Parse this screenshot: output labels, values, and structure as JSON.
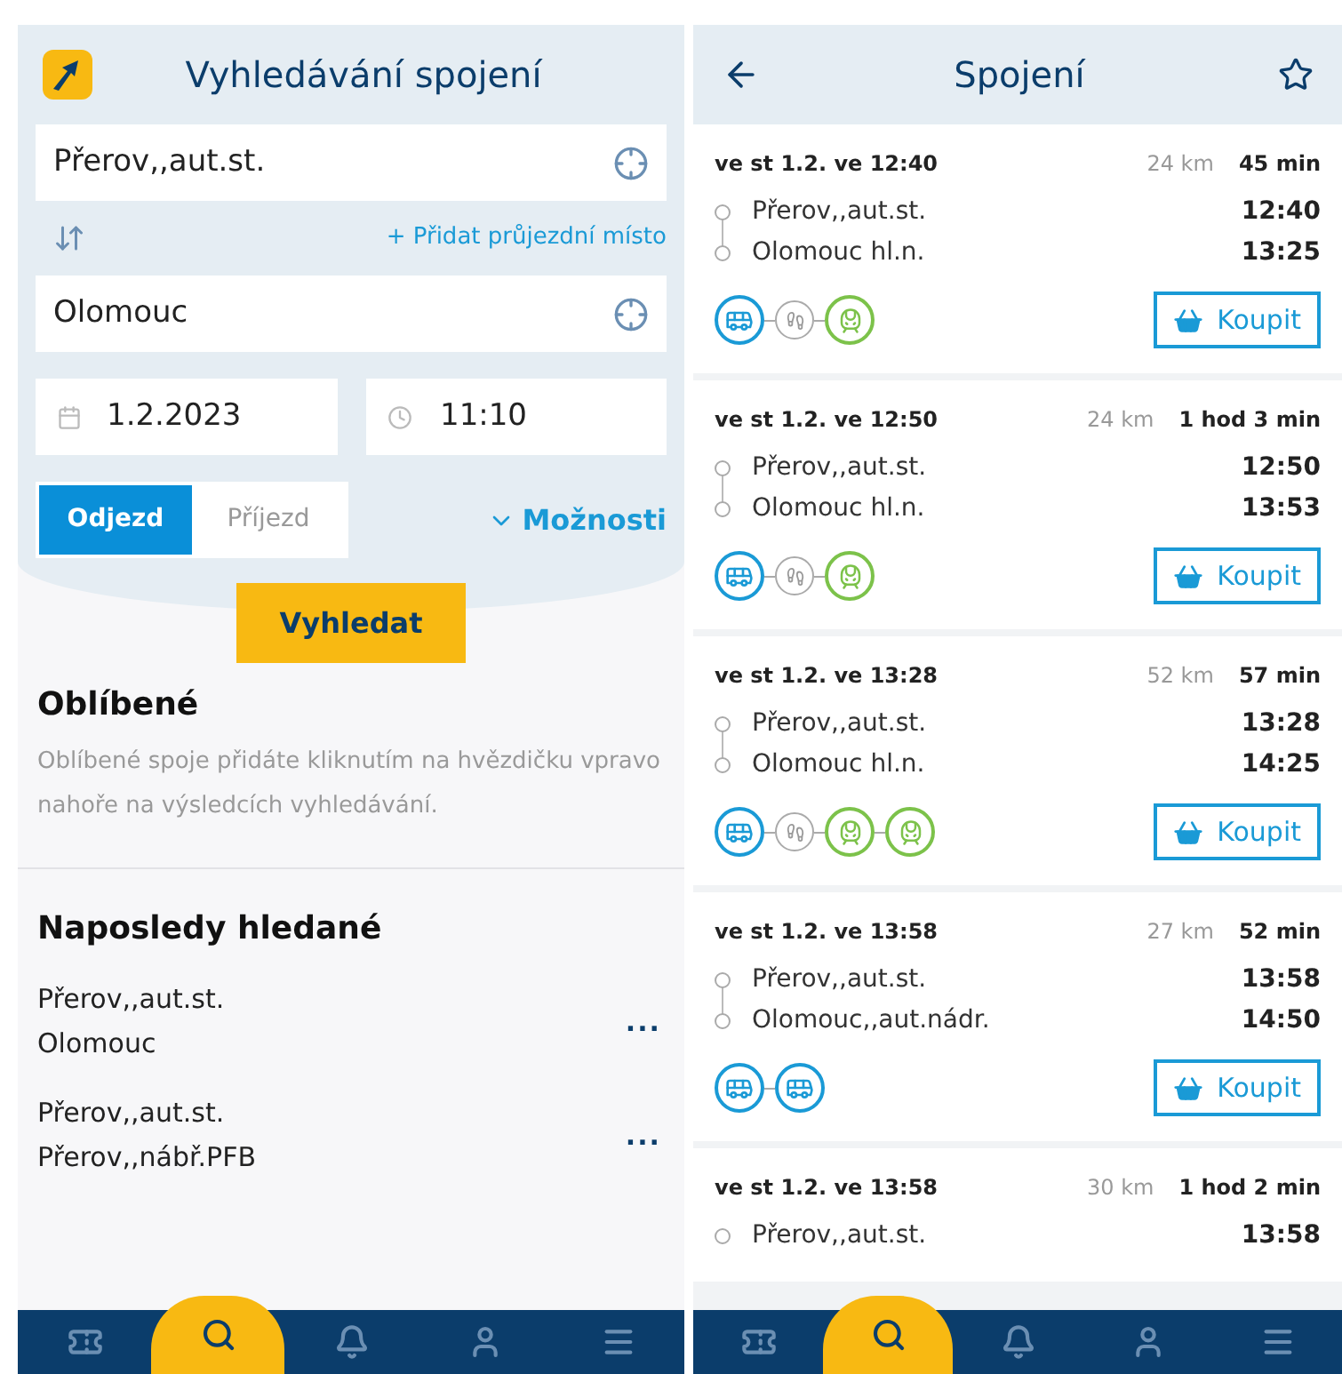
{
  "search_screen": {
    "title": "Vyhledávání spojení",
    "from": {
      "value": "Přerov,,aut.st."
    },
    "add_via": "+ Přidat průjezdní místo",
    "to": {
      "value": "Olomouc"
    },
    "date": {
      "value": "1.2.2023"
    },
    "time": {
      "value": "11:10"
    },
    "mode_tabs": [
      {
        "label": "Odjezd",
        "selected": true
      },
      {
        "label": "Příjezd",
        "selected": false
      }
    ],
    "options": "Možnosti",
    "search_button": "Vyhledat",
    "favorites": {
      "title": "Oblíbené",
      "text": "Oblíbené spoje přidáte kliknutím na hvězdičku vpravo nahoře na výsledcích vyhledávání."
    },
    "recent": {
      "title": "Naposledy hledané",
      "items": [
        {
          "from": "Přerov,,aut.st.",
          "to": "Olomouc",
          "menu": "..."
        },
        {
          "from": "Přerov,,aut.st.",
          "to": "Přerov,,nábř.PFB",
          "menu": "..."
        }
      ]
    },
    "nav": [
      {
        "kind": "ticket",
        "selected": false
      },
      {
        "kind": "search",
        "selected": true
      },
      {
        "kind": "bell",
        "selected": false
      },
      {
        "kind": "user",
        "selected": false
      },
      {
        "kind": "menu",
        "selected": false
      }
    ]
  },
  "results_screen": {
    "title": "Spojení",
    "connections": [
      {
        "date_label": "ve st 1.2. ve 12:40",
        "distance": "24 km",
        "duration": "45 min",
        "stops": [
          {
            "name": "Přerov,,aut.st.",
            "time": "12:40"
          },
          {
            "name": "Olomouc hl.n.",
            "time": "13:25"
          }
        ],
        "legs": [
          {
            "kind": "bus"
          },
          {
            "kind": "walk"
          },
          {
            "kind": "train"
          }
        ],
        "buy": "Koupit"
      },
      {
        "date_label": "ve st 1.2. ve 12:50",
        "distance": "24 km",
        "duration": "1 hod 3 min",
        "stops": [
          {
            "name": "Přerov,,aut.st.",
            "time": "12:50"
          },
          {
            "name": "Olomouc hl.n.",
            "time": "13:53"
          }
        ],
        "legs": [
          {
            "kind": "bus"
          },
          {
            "kind": "walk"
          },
          {
            "kind": "train"
          }
        ],
        "buy": "Koupit"
      },
      {
        "date_label": "ve st 1.2. ve 13:28",
        "distance": "52 km",
        "duration": "57 min",
        "stops": [
          {
            "name": "Přerov,,aut.st.",
            "time": "13:28"
          },
          {
            "name": "Olomouc hl.n.",
            "time": "14:25"
          }
        ],
        "legs": [
          {
            "kind": "bus"
          },
          {
            "kind": "walk"
          },
          {
            "kind": "train"
          },
          {
            "kind": "train"
          }
        ],
        "buy": "Koupit"
      },
      {
        "date_label": "ve st 1.2. ve 13:58",
        "distance": "27 km",
        "duration": "52 min",
        "stops": [
          {
            "name": "Přerov,,aut.st.",
            "time": "13:58"
          },
          {
            "name": "Olomouc,,aut.nádr.",
            "time": "14:50"
          }
        ],
        "legs": [
          {
            "kind": "bus"
          },
          {
            "kind": "bus"
          }
        ],
        "buy": "Koupit"
      },
      {
        "date_label": "ve st 1.2. ve 13:58",
        "distance": "30 km",
        "duration": "1 hod 2 min",
        "stops": [
          {
            "name": "Přerov,,aut.st.",
            "time": "13:58"
          }
        ]
      }
    ],
    "nav": [
      {
        "kind": "ticket",
        "selected": false
      },
      {
        "kind": "search",
        "selected": true
      },
      {
        "kind": "bell",
        "selected": false
      },
      {
        "kind": "user",
        "selected": false
      },
      {
        "kind": "menu",
        "selected": false
      }
    ]
  }
}
